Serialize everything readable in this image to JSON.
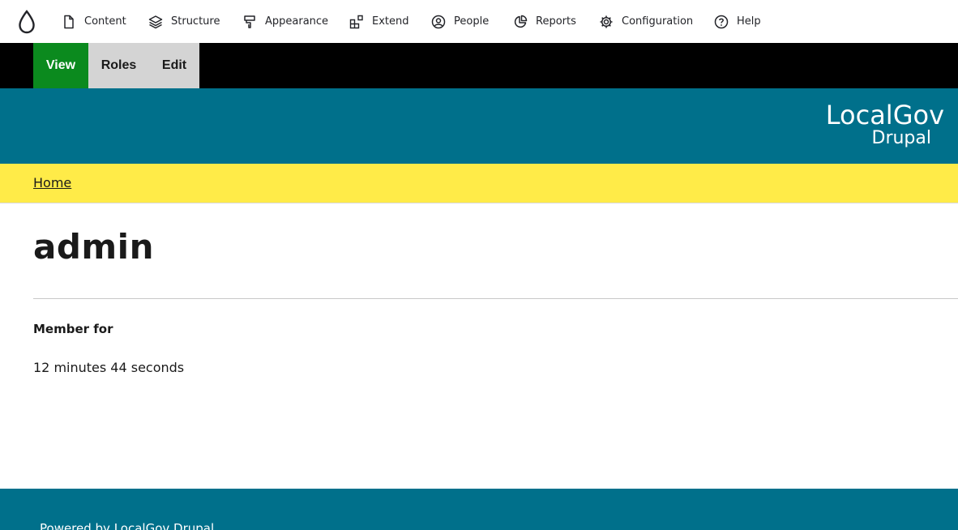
{
  "toolbar": {
    "items": [
      {
        "label": "Content",
        "icon": "document-icon"
      },
      {
        "label": "Structure",
        "icon": "layers-icon"
      },
      {
        "label": "Appearance",
        "icon": "paint-brush-icon"
      },
      {
        "label": "Extend",
        "icon": "puzzle-blocks-icon"
      },
      {
        "label": "People",
        "icon": "user-circle-icon"
      },
      {
        "label": "Reports",
        "icon": "pie-chart-icon"
      },
      {
        "label": "Configuration",
        "icon": "gear-icon"
      },
      {
        "label": "Help",
        "icon": "help-circle-icon"
      }
    ]
  },
  "tabs": [
    {
      "label": "View",
      "active": true
    },
    {
      "label": "Roles",
      "active": false
    },
    {
      "label": "Edit",
      "active": false
    }
  ],
  "brand": {
    "line1": "LocalGov",
    "line2": "Drupal"
  },
  "breadcrumb": {
    "home": "Home"
  },
  "page": {
    "title": "admin",
    "field_label": "Member for",
    "field_value": "12 minutes 44 seconds"
  },
  "footer": {
    "text": "Powered by LocalGov Drupal"
  },
  "colors": {
    "header": "#00708b",
    "breadcrumb_bg": "#ffeb48",
    "active_tab": "#0b8a1e",
    "tab_bg": "#d4d4d4"
  }
}
